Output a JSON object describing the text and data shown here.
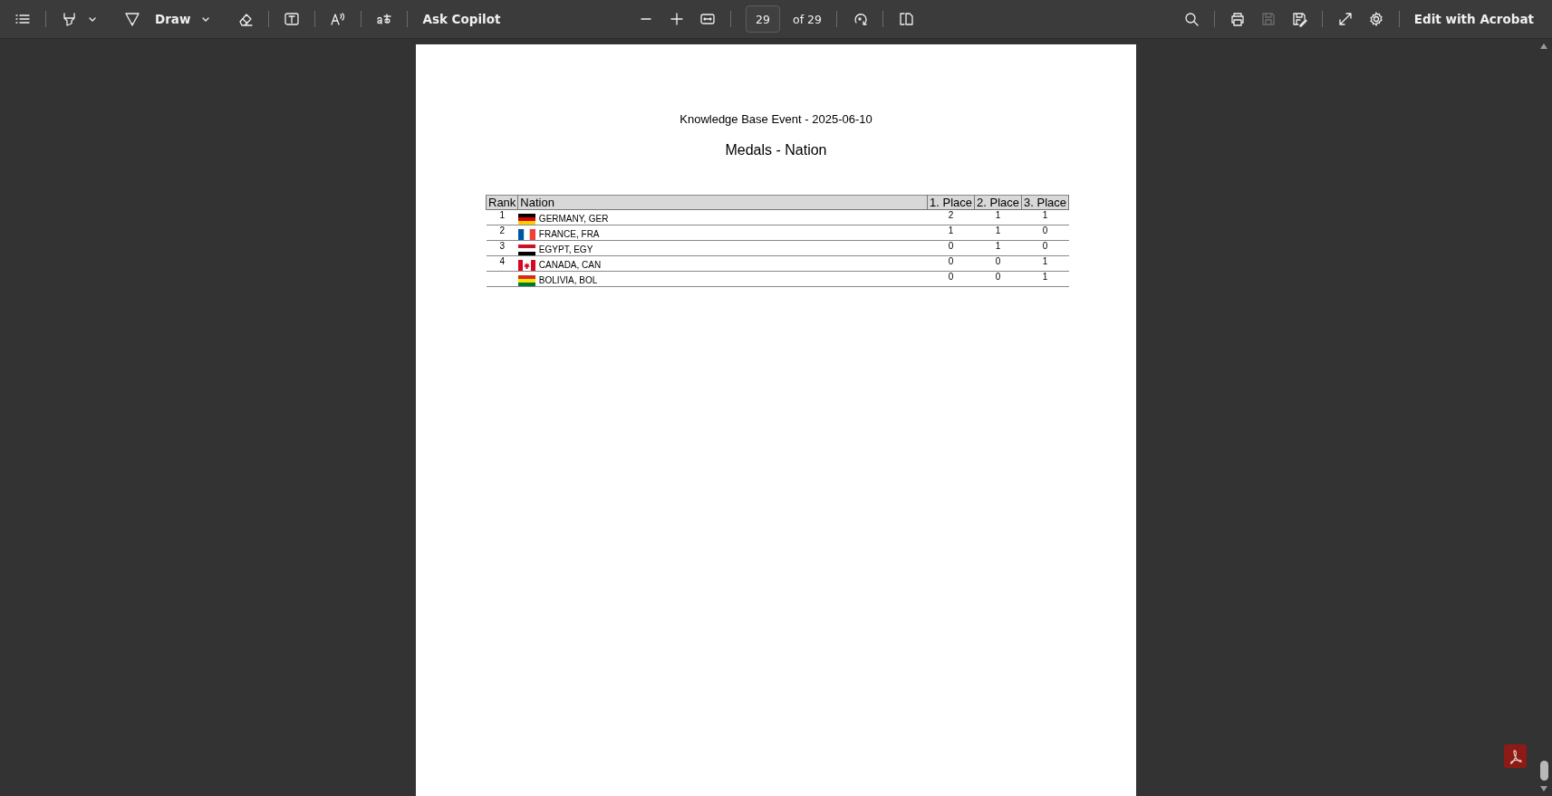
{
  "toolbar": {
    "draw_label": "Draw",
    "ask_copilot": "Ask Copilot",
    "page_number": "29",
    "page_total": "of 29",
    "save_disabled": true,
    "edit_button": "Edit with Acrobat"
  },
  "document": {
    "event_title": "Knowledge Base Event - 2025-06-10",
    "report_title": "Medals - Nation",
    "table": {
      "columns": [
        "Rank",
        "Nation",
        "1. Place",
        "2. Place",
        "3. Place"
      ],
      "rows": [
        {
          "rank": "1",
          "nation": "GERMANY, GER",
          "flag": {
            "kind": "horizontal",
            "stripes": [
              {
                "color": "#000000"
              },
              {
                "color": "#dd0000"
              },
              {
                "color": "#ffce00"
              }
            ]
          },
          "first": "2",
          "second": "1",
          "third": "1"
        },
        {
          "rank": "2",
          "nation": "FRANCE, FRA",
          "flag": {
            "kind": "vertical",
            "stripes": [
              {
                "color": "#0055a4"
              },
              {
                "color": "#ffffff"
              },
              {
                "color": "#ef4135"
              }
            ]
          },
          "first": "1",
          "second": "1",
          "third": "0"
        },
        {
          "rank": "3",
          "nation": "EGYPT, EGY",
          "flag": {
            "kind": "horizontal",
            "stripes": [
              {
                "color": "#ce1126"
              },
              {
                "color": "#ffffff"
              },
              {
                "color": "#000000"
              }
            ]
          },
          "first": "0",
          "second": "1",
          "third": "0"
        },
        {
          "rank": "4",
          "nation": "CANADA, CAN",
          "flag": {
            "kind": "canada",
            "stripes": [
              {
                "color": "#d80621"
              },
              {
                "color": "#ffffff"
              },
              {
                "color": "#d80621"
              }
            ]
          },
          "first": "0",
          "second": "0",
          "third": "1"
        },
        {
          "nation": "BOLIVIA, BOL",
          "flag": {
            "kind": "horizontal",
            "stripes": [
              {
                "color": "#d52b1e"
              },
              {
                "color": "#f9e300"
              },
              {
                "color": "#007934"
              }
            ]
          },
          "first": "0",
          "second": "0",
          "third": "1"
        }
      ]
    }
  }
}
